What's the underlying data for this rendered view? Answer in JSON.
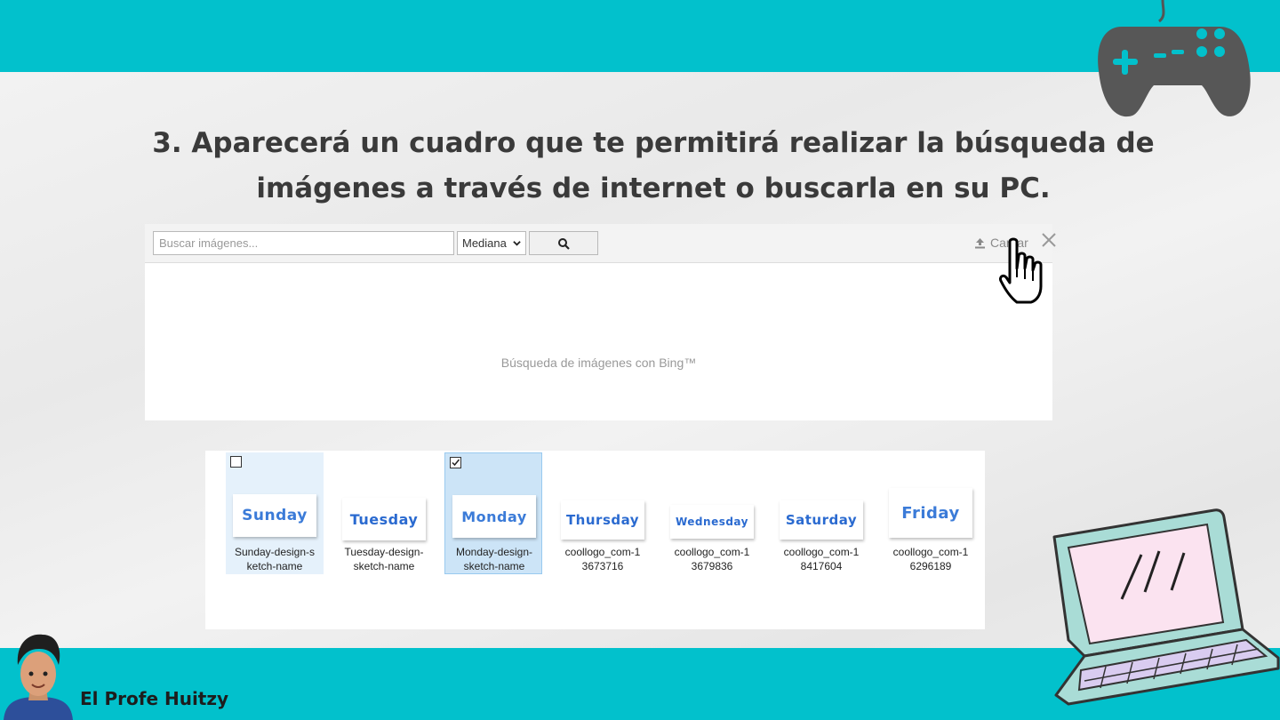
{
  "slide": {
    "heading": "3. Aparecerá un cuadro que te permitirá realizar la búsqueda de imágenes a través de internet o buscarla en su PC.",
    "brand": "El Profe Huitzy",
    "accent_color": "#02c1cc"
  },
  "dialog": {
    "search_placeholder": "Buscar imágenes...",
    "size_select_value": "Mediana",
    "search_button_icon": "magnifier-icon",
    "upload_label": "Cargar",
    "close_icon": "close-icon",
    "caption": "Búsqueda de imágenes con Bing™"
  },
  "files": [
    {
      "thumb_text": "Sunday",
      "name_line1": "Sunday-design-s",
      "name_line2": "ketch-name",
      "checked": false,
      "state": "hover"
    },
    {
      "thumb_text": "Tuesday",
      "name_line1": "Tuesday-design-",
      "name_line2": "sketch-name",
      "checked": false,
      "state": "none"
    },
    {
      "thumb_text": "Monday",
      "name_line1": "Monday-design-",
      "name_line2": "sketch-name",
      "checked": true,
      "state": "selected"
    },
    {
      "thumb_text": "Thursday",
      "name_line1": "coollogo_com-1",
      "name_line2": "3673716",
      "checked": false,
      "state": "none"
    },
    {
      "thumb_text": "Wednesday",
      "name_line1": "coollogo_com-1",
      "name_line2": "3679836",
      "checked": false,
      "state": "none"
    },
    {
      "thumb_text": "Saturday",
      "name_line1": "coollogo_com-1",
      "name_line2": "8417604",
      "checked": false,
      "state": "none"
    },
    {
      "thumb_text": "Friday",
      "name_line1": "coollogo_com-1",
      "name_line2": "6296189",
      "checked": false,
      "state": "none"
    }
  ]
}
